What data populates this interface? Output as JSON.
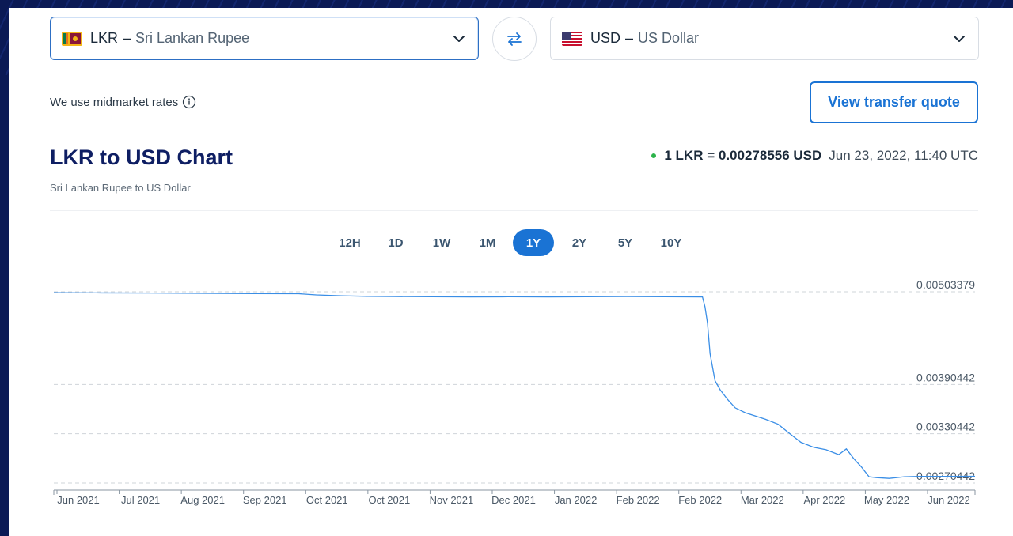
{
  "from": {
    "code": "LKR",
    "sep": "–",
    "name": "Sri Lankan Rupee",
    "flag": "sri-lanka-flag"
  },
  "to": {
    "code": "USD",
    "sep": "–",
    "name": "US Dollar",
    "flag": "us-flag"
  },
  "midmarket_text": "We use midmarket rates",
  "quote_button": "View transfer quote",
  "title": "LKR to USD Chart",
  "subtitle": "Sri Lankan Rupee to US Dollar",
  "rate": {
    "value": "1 LKR = 0.00278556 USD",
    "time": "Jun 23, 2022, 11:40 UTC"
  },
  "ranges": [
    {
      "label": "12H",
      "active": false
    },
    {
      "label": "1D",
      "active": false
    },
    {
      "label": "1W",
      "active": false
    },
    {
      "label": "1M",
      "active": false
    },
    {
      "label": "1Y",
      "active": true
    },
    {
      "label": "2Y",
      "active": false
    },
    {
      "label": "5Y",
      "active": false
    },
    {
      "label": "10Y",
      "active": false
    }
  ],
  "colors": {
    "accent": "#1a73d4",
    "line": "#3a8ee6",
    "title": "#0e1e63",
    "live": "#2cb34a"
  },
  "chart_data": {
    "type": "line",
    "title": "LKR to USD Chart",
    "subtitle": "Sri Lankan Rupee to US Dollar",
    "xlabel": "",
    "ylabel": "",
    "x_ticks": [
      "Jun 2021",
      "Jul 2021",
      "Aug 2021",
      "Sep 2021",
      "Oct 2021",
      "Oct 2021",
      "Nov 2021",
      "Dec 2021",
      "Jan 2022",
      "Feb 2022",
      "Feb 2022",
      "Mar 2022",
      "Apr 2022",
      "May 2022",
      "Jun 2022"
    ],
    "y_ticks": [
      0.00503379,
      0.00390442,
      0.00330442,
      0.00270442
    ],
    "ylim": [
      0.00270442,
      0.00503379
    ],
    "grid": "dashed horizontal",
    "legend": "none",
    "series": [
      {
        "x": [
          "2021-06-23",
          "2021-07-10",
          "2021-08-01",
          "2021-08-20",
          "2021-09-10",
          "2021-09-28",
          "2021-10-05",
          "2021-10-15",
          "2021-10-25",
          "2021-11-05",
          "2021-11-20",
          "2021-12-05",
          "2021-12-20",
          "2022-01-05",
          "2022-01-20",
          "2022-02-05",
          "2022-02-20",
          "2022-03-07",
          "2022-03-08",
          "2022-03-09",
          "2022-03-10",
          "2022-03-12",
          "2022-03-14",
          "2022-03-17",
          "2022-03-20",
          "2022-03-24",
          "2022-03-28",
          "2022-04-01",
          "2022-04-06",
          "2022-04-10",
          "2022-04-15",
          "2022-04-20",
          "2022-04-25",
          "2022-04-30",
          "2022-05-03",
          "2022-05-06",
          "2022-05-09",
          "2022-05-12",
          "2022-05-15",
          "2022-05-20",
          "2022-05-26",
          "2022-06-01",
          "2022-06-10",
          "2022-06-23"
        ],
        "y": [
          0.005022,
          0.00502,
          0.005018,
          0.005015,
          0.005012,
          0.00501,
          0.004995,
          0.004985,
          0.004978,
          0.004975,
          0.004972,
          0.00497,
          0.004972,
          0.00497,
          0.004972,
          0.004975,
          0.004972,
          0.00497,
          0.00485,
          0.00465,
          0.00428,
          0.00395,
          0.00384,
          0.00372,
          0.00362,
          0.00356,
          0.00352,
          0.00348,
          0.00342,
          0.00332,
          0.0032,
          0.00314,
          0.00311,
          0.00305,
          0.00312,
          0.003,
          0.0029,
          0.00278,
          0.00277,
          0.00276,
          0.00278,
          0.002785,
          0.002785,
          0.002786
        ]
      }
    ]
  }
}
